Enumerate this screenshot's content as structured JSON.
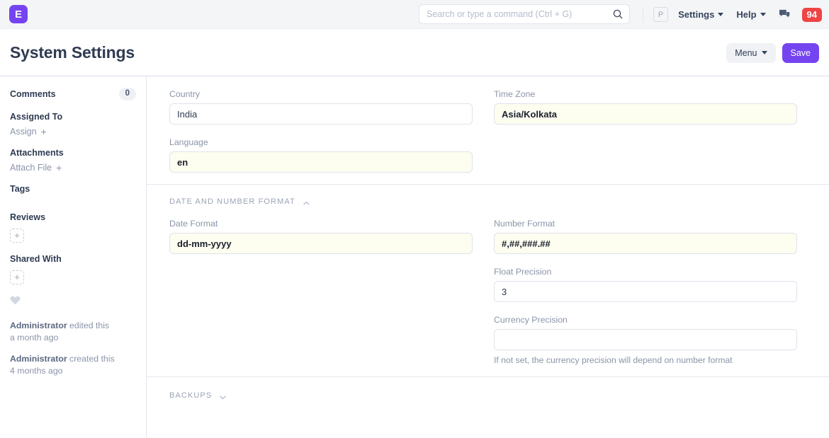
{
  "navbar": {
    "logo_letter": "E",
    "search": {
      "placeholder": "Search or type a command (Ctrl + G)",
      "value": "",
      "icon": "search-icon"
    },
    "avatar_letter": "P",
    "settings_label": "Settings",
    "help_label": "Help",
    "chat_icon": "comments-icon",
    "notification_count": "94",
    "notification_color": "#ef4444"
  },
  "header": {
    "title": "System Settings",
    "menu_label": "Menu",
    "save_label": "Save",
    "primary_color": "#7544f1"
  },
  "sidebar": {
    "comments_label": "Comments",
    "comments_count": "0",
    "assigned_to_label": "Assigned To",
    "assign_action": "Assign",
    "attachments_label": "Attachments",
    "attach_action": "Attach File",
    "tags_label": "Tags",
    "reviews_label": "Reviews",
    "shared_with_label": "Shared With",
    "add_glyph": "+",
    "like_icon": "heart-icon",
    "activity": [
      {
        "user": "Administrator",
        "action": "edited this",
        "time": "a month ago"
      },
      {
        "user": "Administrator",
        "action": "created this",
        "time": "4 months ago"
      }
    ]
  },
  "form": {
    "general": {
      "country": {
        "label": "Country",
        "value": "India",
        "modified": false
      },
      "time_zone": {
        "label": "Time Zone",
        "value": "Asia/Kolkata",
        "modified": true
      },
      "language": {
        "label": "Language",
        "value": "en",
        "modified": true
      }
    },
    "date_number": {
      "section_label": "Date and Number Format",
      "collapsed": false,
      "date_format": {
        "label": "Date Format",
        "value": "dd-mm-yyyy",
        "modified": true
      },
      "number_format": {
        "label": "Number Format",
        "value": "#,##,###.##",
        "modified": true
      },
      "float_precision": {
        "label": "Float Precision",
        "value": "3",
        "modified": false
      },
      "currency_precision": {
        "label": "Currency Precision",
        "value": "",
        "help": "If not set, the currency precision will depend on number format",
        "modified": false
      }
    },
    "backups": {
      "section_label": "Backups",
      "collapsed": true
    }
  }
}
